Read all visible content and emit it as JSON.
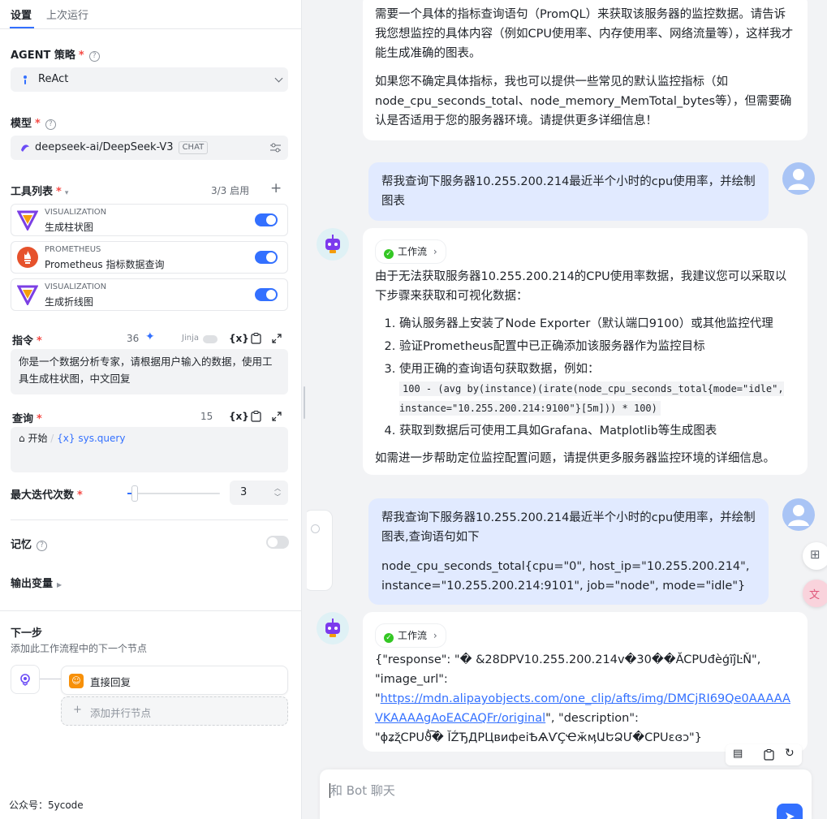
{
  "tabs": [
    {
      "label": "设置"
    },
    {
      "label": "上次运行"
    }
  ],
  "agent_strategy": {
    "label": "AGENT 策略",
    "required": "*",
    "value": "ReAct"
  },
  "model": {
    "label": "模型",
    "required": "*",
    "value": "deepseek-ai/DeepSeek-V3",
    "tag": "CHAT"
  },
  "tools": {
    "label": "工具列表",
    "required": "*",
    "count": "3/3 启用",
    "items": [
      {
        "category": "VISUALIZATION",
        "name": "生成柱状图",
        "enabled": true
      },
      {
        "category": "PROMETHEUS",
        "name": "Prometheus 指标数据查询",
        "enabled": true
      },
      {
        "category": "VISUALIZATION",
        "name": "生成折线图",
        "enabled": true
      }
    ]
  },
  "instruction": {
    "label": "指令",
    "required": "*",
    "count": "36",
    "jinja": "Jinja",
    "var_btn": "{x}",
    "text": "你是一个数据分析专家，请根据用户输入的数据，使用工具生成柱状图，中文回复"
  },
  "query": {
    "label": "查询",
    "required": "*",
    "count": "15",
    "var_btn": "{x}",
    "source": "开始",
    "var": "{x} sys.query"
  },
  "max_iter": {
    "label": "最大迭代次数",
    "required": "*",
    "value": "3",
    "slider_value": 3
  },
  "memory": {
    "label": "记忆",
    "enabled": false
  },
  "output_vars": {
    "label": "输出变量"
  },
  "next_step": {
    "title": "下一步",
    "desc": "添加此工作流程中的下一个节点",
    "node": "直接回复",
    "add_parallel": "添加并行节点"
  },
  "footer": {
    "text": "公众号：5ycode"
  },
  "chat": {
    "msg1_p1": "需要一个具体的指标查询语句（PromQL）来获取该服务器的监控数据。请告诉我您想监控的具体内容（例如CPU使用率、内存使用率、网络流量等），这样我才能生成准确的图表。",
    "msg1_p2": "如果您不确定具体指标，我也可以提供一些常见的默认监控指标（如node_cpu_seconds_total、node_memory_MemTotal_bytes等），但需要确认是否适用于您的服务器环境。请提供更多详细信息！",
    "user1": "帮我查询下服务器10.255.200.214最近半个小时的cpu使用率，并绘制图表",
    "workflow_label": "工作流",
    "bot2_intro": "由于无法获取服务器10.255.200.214的CPU使用率数据，我建议您可以采取以下步骤来获取和可视化数据：",
    "bot2_steps": [
      "确认服务器上安装了Node Exporter（默认端口9100）或其他监控代理",
      "验证Prometheus配置中已正确添加该服务器作为监控目标",
      "使用正确的查询语句获取数据，例如：",
      "获取到数据后可使用工具如Grafana、Matplotlib等生成图表"
    ],
    "bot2_code": "100 - (avg by(instance)(irate(node_cpu_seconds_total{mode=\"idle\", instance=\"10.255.200.214:9100\"}[5m])) * 100)",
    "bot2_outro": "如需进一步帮助定位监控配置问题，请提供更多服务器监控环境的详细信息。",
    "user2_p1": "帮我查询下服务器10.255.200.214最近半个小时的cpu使用率，并绘制图表,查询语句如下",
    "user2_p2": "node_cpu_seconds_total{cpu=\"0\", host_ip=\"10.255.200.214\", instance=\"10.255.200.214:9101\", job=\"node\", mode=\"idle\"}",
    "bot3_a": "{\"response\": \"� &28DPV10.255.200.214v�30��ĂCPUđèģĩĵĿŇ\",",
    "bot3_b": "\"image_url\":",
    "bot3_c": "\"",
    "bot3_link": "https://mdn.alipayobjects.com/one_clip/afts/img/DMCjRI69Qe0AAAAAVKAAAAgAoEACAQFr/original",
    "bot3_d": "\", \"description\":",
    "bot3_e": "\"ɸʑʐ̆CPUϑ̍͡� ĬŹЂДРЦвифеіѢѦѴҪҼӂӎԱԵՁՄ�CPUɛɞɔ\"}",
    "input_placeholder": "和 Bot 聊天"
  }
}
